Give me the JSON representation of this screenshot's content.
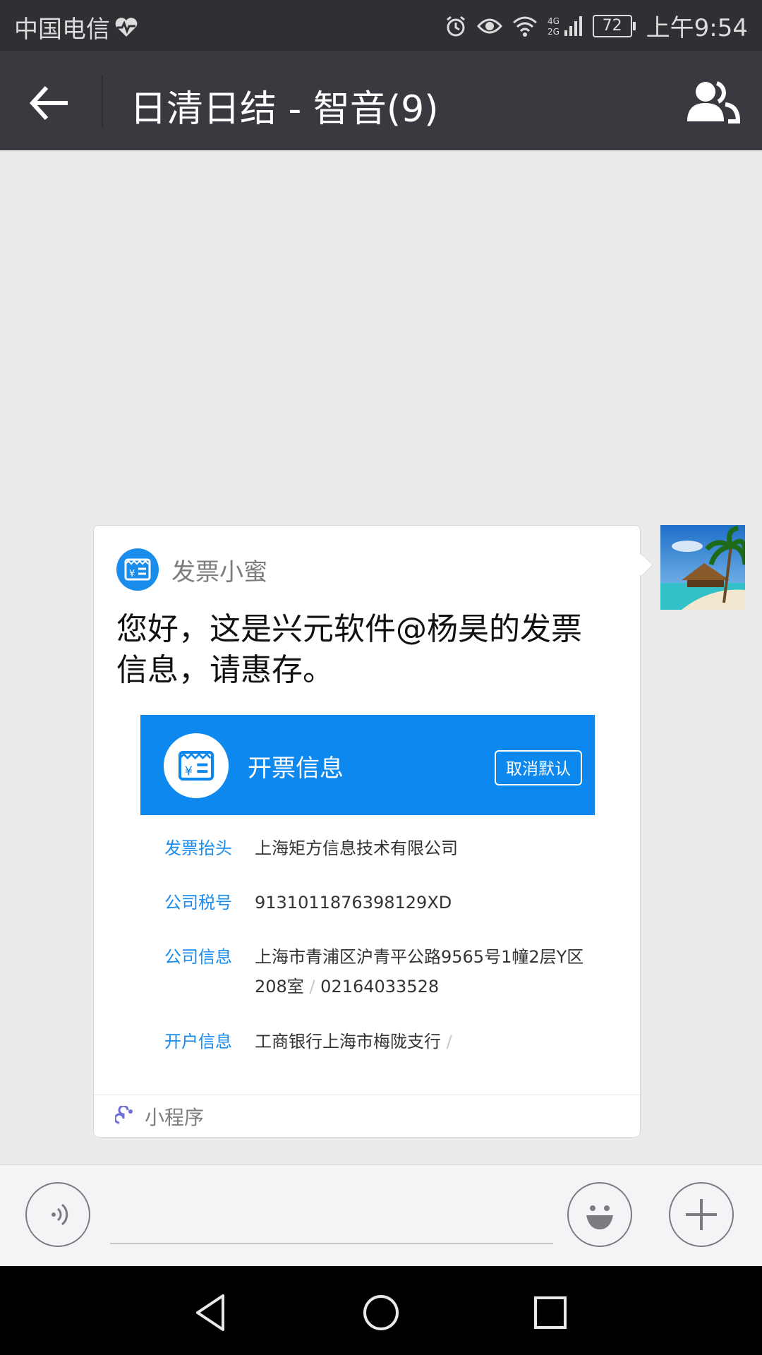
{
  "status_bar": {
    "carrier": "中国电信",
    "battery": "72",
    "time": "上午9:54",
    "icons": [
      "heart-pulse-icon",
      "alarm-icon",
      "eye-icon",
      "wifi-icon",
      "signal-4g-2g-icon",
      "battery-icon"
    ]
  },
  "header": {
    "title": "日清日结 - 智音(9)"
  },
  "message": {
    "app_name": "发票小蜜",
    "text": "您好，这是兴元软件@杨昊的发票信息，请惠存。",
    "card": {
      "title": "开票信息",
      "cancel_default": "取消默认",
      "rows": [
        {
          "label": "发票抬头",
          "value": "上海矩方信息技术有限公司"
        },
        {
          "label": "公司税号",
          "value": "9131011876398129XD"
        },
        {
          "label": "公司信息",
          "value": "上海市青浦区沪青平公路9565号1幢2层Y区208室",
          "extra": "02164033528"
        },
        {
          "label": "开户信息",
          "value": "工商银行上海市梅陇支行"
        }
      ]
    },
    "footer_label": "小程序"
  },
  "input_bar": {
    "placeholder": ""
  },
  "colors": {
    "title_bar": "#393a3f",
    "status_bar": "#2f3034",
    "accent_blue": "#0d88ef",
    "chat_bg": "#ebebeb"
  }
}
